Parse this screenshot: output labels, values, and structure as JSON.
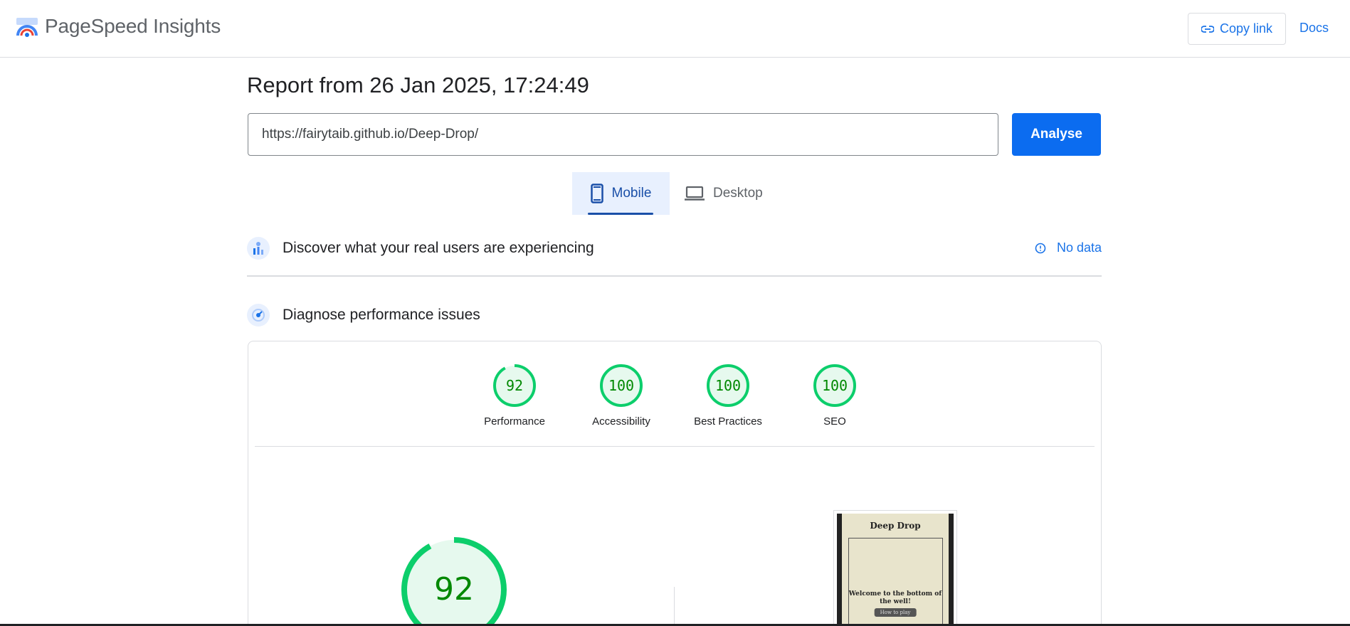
{
  "header": {
    "app_title": "PageSpeed Insights",
    "copy_link_label": "Copy link",
    "docs_label": "Docs"
  },
  "report": {
    "title": "Report from 26 Jan 2025, 17:24:49",
    "url_value": "https://fairytaib.github.io/Deep-Drop/",
    "analyse_label": "Analyse"
  },
  "tabs": [
    {
      "label": "Mobile",
      "selected": true
    },
    {
      "label": "Desktop",
      "selected": false
    }
  ],
  "field_data": {
    "title": "Discover what your real users are experiencing",
    "status": "No data"
  },
  "diagnose": {
    "title": "Diagnose performance issues",
    "scores": [
      {
        "label": "Performance",
        "value": "92",
        "fraction": 0.92
      },
      {
        "label": "Accessibility",
        "value": "100",
        "fraction": 1.0
      },
      {
        "label": "Best Practices",
        "value": "100",
        "fraction": 1.0
      },
      {
        "label": "SEO",
        "value": "100",
        "fraction": 1.0
      }
    ],
    "main_score": "92",
    "main_fraction": 0.92
  },
  "screenshot": {
    "title": "Deep Drop",
    "text": "Welcome to the bottom of the well!",
    "button": "How to play"
  },
  "colors": {
    "accent": "#1a73e8",
    "pass": "#0cce6b",
    "pass_text": "#008800",
    "pass_fill": "#e6f9ee"
  }
}
